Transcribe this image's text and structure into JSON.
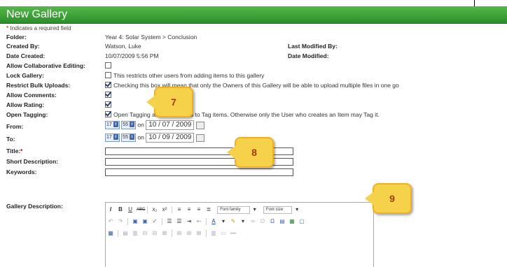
{
  "header": {
    "title": "New Gallery"
  },
  "required_note": {
    "star": "*",
    "text": " Indicates a required field"
  },
  "fields": {
    "folder": {
      "label": "Folder:",
      "value": "Year 4: Solar System > Conclusion"
    },
    "created_by": {
      "label": "Created By:",
      "value": "Watson, Luke"
    },
    "last_modified_by": {
      "label": "Last Modified By:"
    },
    "date_created": {
      "label": "Date Created:",
      "value": "10/07/2009 5:56 PM"
    },
    "date_modified": {
      "label": "Date Modified:"
    },
    "allow_collab": {
      "label": "Allow Collaborative Editing:",
      "checked": false
    },
    "lock_gallery": {
      "label": "Lock Gallery:",
      "checked": false,
      "text": "This restricts other users from adding items to this gallery"
    },
    "restrict_bulk": {
      "label": "Restrict Bulk Uploads:",
      "checked": true,
      "text": "Checking this box will mean that only the Owners of this Gallery will be able to upload multiple files in one go"
    },
    "allow_comments": {
      "label": "Allow Comments:",
      "checked": true
    },
    "allow_rating": {
      "label": "Allow Rating:",
      "checked": true
    },
    "open_tagging": {
      "label": "Open Tagging:",
      "checked": true,
      "text": "Open Tagging allows all Users to Tag items. Otherwise only the User who creates an Item may Tag it."
    },
    "from": {
      "label": "From:",
      "hour": "17",
      "minute": "55",
      "on": "on",
      "date": "10 / 07 / 2009"
    },
    "to": {
      "label": "To:",
      "hour": "17",
      "minute": "55",
      "on": "on",
      "date": "10 / 09 / 2009"
    },
    "title": {
      "label": "Title:",
      "star": "*",
      "value": ""
    },
    "short_description": {
      "label": "Short Description:",
      "value": ""
    },
    "keywords": {
      "label": "Keywords:",
      "value": ""
    },
    "gallery_description": {
      "label": "Gallery Description:"
    }
  },
  "editor": {
    "font_family": "Font family",
    "font_size": "Font size"
  },
  "callouts": {
    "c7": "7",
    "c8": "8",
    "c9": "9"
  },
  "colors": {
    "header": "#3a9e35",
    "callout": "#f6d24a",
    "callout_text": "#a23b00"
  }
}
